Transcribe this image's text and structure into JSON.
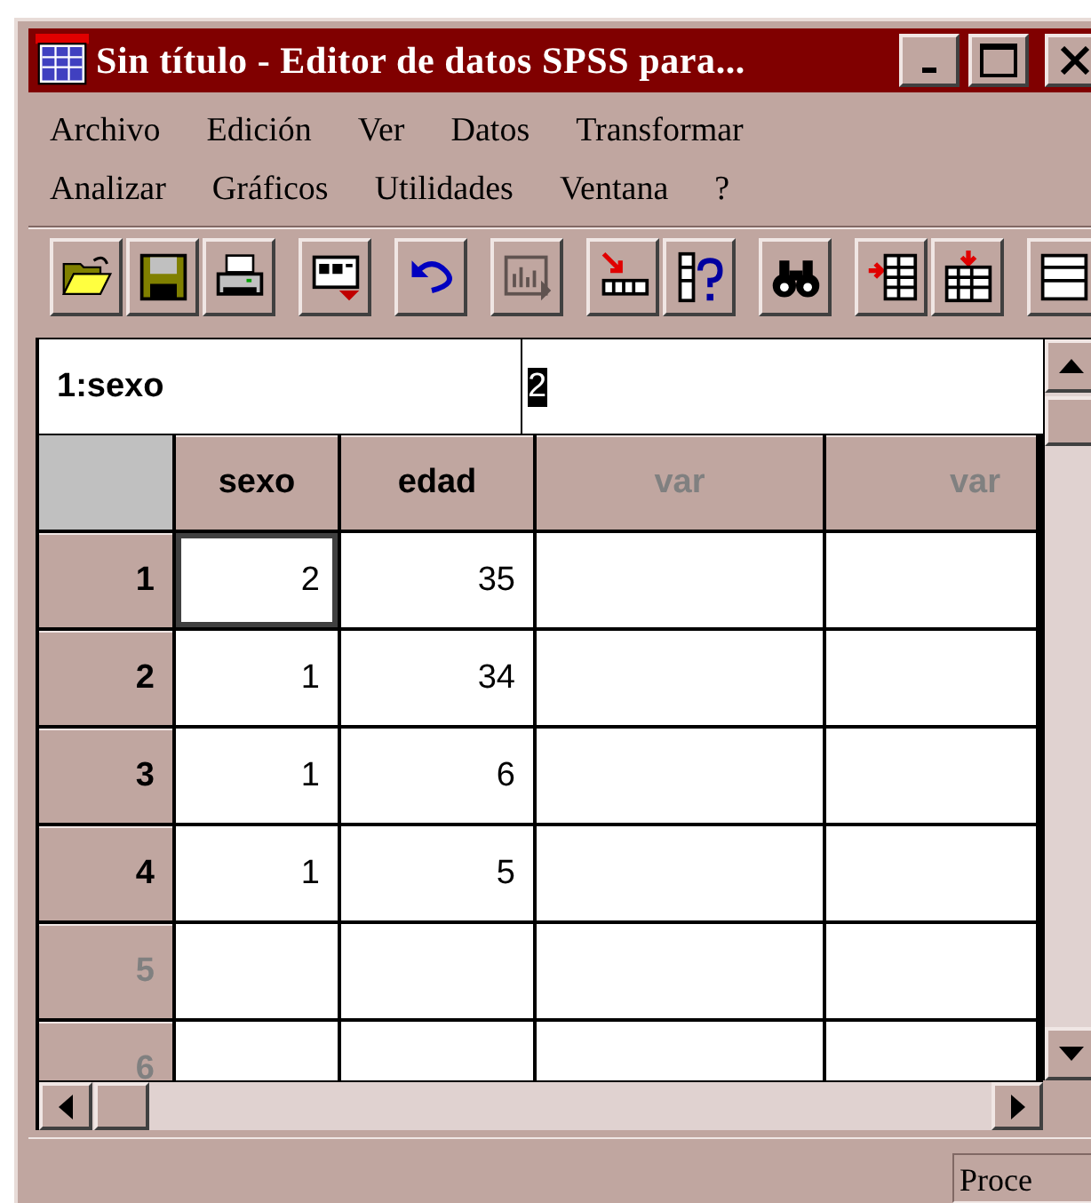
{
  "window": {
    "title": "Sin título - Editor de datos SPSS para..."
  },
  "menu_rows": [
    [
      {
        "label": "Archivo"
      },
      {
        "label": "Edición"
      },
      {
        "label": "Ver"
      },
      {
        "label": "Datos"
      },
      {
        "label": "Transformar"
      }
    ],
    [
      {
        "label": "Analizar"
      },
      {
        "label": "Gráficos"
      },
      {
        "label": "Utilidades"
      },
      {
        "label": "Ventana"
      },
      {
        "label": "?"
      }
    ]
  ],
  "toolbar": [
    [
      {
        "kind": "open",
        "disabled": false
      },
      {
        "kind": "save",
        "disabled": false
      },
      {
        "kind": "print",
        "disabled": false
      }
    ],
    [
      {
        "kind": "dialog",
        "disabled": false
      }
    ],
    [
      {
        "kind": "undo",
        "disabled": false
      }
    ],
    [
      {
        "kind": "chart",
        "disabled": true
      }
    ],
    [
      {
        "kind": "goto",
        "disabled": false
      },
      {
        "kind": "info",
        "disabled": false
      }
    ],
    [
      {
        "kind": "find",
        "disabled": false
      }
    ],
    [
      {
        "kind": "insert_case",
        "disabled": false
      },
      {
        "kind": "insert_var",
        "disabled": false
      }
    ],
    [
      {
        "kind": "split",
        "disabled": false
      }
    ]
  ],
  "cell_editor": {
    "reference": "1:sexo",
    "value": "2"
  },
  "grid": {
    "columns": [
      {
        "label": "sexo",
        "defined": true
      },
      {
        "label": "edad",
        "defined": true
      },
      {
        "label": "var",
        "defined": false
      },
      {
        "label": "var",
        "defined": false
      }
    ],
    "rows": [
      {
        "number": "1",
        "defined": true,
        "cells": [
          {
            "value": "2",
            "selected": true
          },
          {
            "value": "35",
            "selected": false
          }
        ]
      },
      {
        "number": "2",
        "defined": true,
        "cells": [
          {
            "value": "1",
            "selected": false
          },
          {
            "value": "34",
            "selected": false
          }
        ]
      },
      {
        "number": "3",
        "defined": true,
        "cells": [
          {
            "value": "1",
            "selected": false
          },
          {
            "value": "6",
            "selected": false
          }
        ]
      },
      {
        "number": "4",
        "defined": true,
        "cells": [
          {
            "value": "1",
            "selected": false
          },
          {
            "value": "5",
            "selected": false
          }
        ]
      },
      {
        "number": "5",
        "defined": false,
        "cells": []
      },
      {
        "number": "6",
        "defined": false,
        "cells": []
      }
    ]
  },
  "status_bar": {
    "text": "Proce"
  }
}
